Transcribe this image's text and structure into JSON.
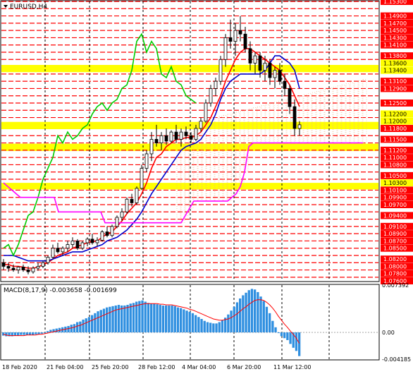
{
  "chart_data": [
    {
      "type": "candlestick",
      "symbol": "EURUSD,H4",
      "ylim": [
        1.076,
        1.153
      ],
      "y_ticks": [
        "1.15300",
        "1.14900",
        "1.14700",
        "1.14500",
        "1.14300",
        "1.14100",
        "1.13800",
        "1.13600",
        "1.13400",
        "1.13100",
        "1.12900",
        "1.12500",
        "1.12200",
        "1.12000",
        "1.11800",
        "1.11500",
        "1.11200",
        "1.11000",
        "1.10800",
        "1.10500",
        "1.10300",
        "1.10100",
        "1.09900",
        "1.09700",
        "1.09400",
        "1.09100",
        "1.08900",
        "1.08700",
        "1.08500",
        "1.08200",
        "1.08000",
        "1.07800",
        "1.07600"
      ],
      "highlight_ticks": [
        "1.13600",
        "1.13400",
        "1.12200",
        "1.12000",
        "1.10300"
      ],
      "x_ticks": [
        "18 Feb 2020",
        "21 Feb 04:00",
        "25 Feb 20:00",
        "28 Feb 12:00",
        "4 Mar 04:00",
        "6 Mar 20:00",
        "11 Mar 12:00"
      ],
      "red_levels": [
        1.153,
        1.151,
        1.149,
        1.147,
        1.145,
        1.143,
        1.141,
        1.139,
        1.137,
        1.133,
        1.131,
        1.129,
        1.127,
        1.125,
        1.123,
        1.121,
        1.116,
        1.114,
        1.112,
        1.11,
        1.108,
        1.106,
        1.104,
        1.101,
        1.099,
        1.097,
        1.095,
        1.093,
        1.091,
        1.089,
        1.087,
        1.085,
        1.083,
        1.081,
        1.079,
        1.077
      ],
      "yellow_bands": [
        [
          1.1335,
          1.1355
        ],
        [
          1.1178,
          1.1198
        ],
        [
          1.1118,
          1.1138
        ],
        [
          1.1012,
          1.103
        ]
      ],
      "candles": [
        [
          1.081,
          1.082,
          1.079,
          1.08
        ],
        [
          1.08,
          1.081,
          1.0785,
          1.0795
        ],
        [
          1.0795,
          1.0805,
          1.0785,
          1.079
        ],
        [
          1.079,
          1.08,
          1.078,
          1.0798
        ],
        [
          1.0798,
          1.0805,
          1.0785,
          1.079
        ],
        [
          1.079,
          1.08,
          1.0778,
          1.0785
        ],
        [
          1.0785,
          1.08,
          1.078,
          1.0795
        ],
        [
          1.0795,
          1.081,
          1.0788,
          1.08
        ],
        [
          1.08,
          1.0815,
          1.0795,
          1.081
        ],
        [
          1.081,
          1.083,
          1.0805,
          1.0825
        ],
        [
          1.0825,
          1.086,
          1.082,
          1.085
        ],
        [
          1.085,
          1.0865,
          1.0835,
          1.084
        ],
        [
          1.084,
          1.0855,
          1.083,
          1.085
        ],
        [
          1.085,
          1.087,
          1.084,
          1.086
        ],
        [
          1.086,
          1.088,
          1.085,
          1.087
        ],
        [
          1.087,
          1.0875,
          1.0845,
          1.085
        ],
        [
          1.085,
          1.087,
          1.0845,
          1.0865
        ],
        [
          1.0865,
          1.088,
          1.0855,
          1.0875
        ],
        [
          1.0875,
          1.089,
          1.086,
          1.0865
        ],
        [
          1.0865,
          1.088,
          1.0855,
          1.0872
        ],
        [
          1.0872,
          1.09,
          1.0868,
          1.0895
        ],
        [
          1.0895,
          1.091,
          1.088,
          1.0885
        ],
        [
          1.0885,
          1.0915,
          1.088,
          1.091
        ],
        [
          1.091,
          1.094,
          1.0905,
          1.0935
        ],
        [
          1.0935,
          1.096,
          1.0925,
          1.095
        ],
        [
          1.095,
          1.099,
          1.0945,
          1.0985
        ],
        [
          1.0985,
          1.1,
          1.0965,
          1.0975
        ],
        [
          1.0975,
          1.102,
          1.097,
          1.1015
        ],
        [
          1.1015,
          1.108,
          1.101,
          1.107
        ],
        [
          1.107,
          1.112,
          1.106,
          1.111
        ],
        [
          1.111,
          1.117,
          1.109,
          1.115
        ],
        [
          1.115,
          1.119,
          1.113,
          1.114
        ],
        [
          1.114,
          1.117,
          1.112,
          1.116
        ],
        [
          1.116,
          1.118,
          1.1135,
          1.1145
        ],
        [
          1.1145,
          1.1175,
          1.114,
          1.117
        ],
        [
          1.117,
          1.119,
          1.114,
          1.115
        ],
        [
          1.115,
          1.118,
          1.113,
          1.117
        ],
        [
          1.117,
          1.1185,
          1.115,
          1.116
        ],
        [
          1.116,
          1.117,
          1.114,
          1.115
        ],
        [
          1.115,
          1.119,
          1.1145,
          1.118
        ],
        [
          1.118,
          1.121,
          1.117,
          1.12
        ],
        [
          1.12,
          1.126,
          1.1195,
          1.125
        ],
        [
          1.125,
          1.13,
          1.124,
          1.129
        ],
        [
          1.129,
          1.132,
          1.127,
          1.131
        ],
        [
          1.131,
          1.138,
          1.13,
          1.137
        ],
        [
          1.137,
          1.144,
          1.135,
          1.143
        ],
        [
          1.143,
          1.148,
          1.14,
          1.142
        ],
        [
          1.142,
          1.147,
          1.138,
          1.145
        ],
        [
          1.145,
          1.149,
          1.142,
          1.144
        ],
        [
          1.144,
          1.146,
          1.139,
          1.14
        ],
        [
          1.14,
          1.142,
          1.134,
          1.136
        ],
        [
          1.136,
          1.139,
          1.133,
          1.138
        ],
        [
          1.138,
          1.139,
          1.132,
          1.134
        ],
        [
          1.134,
          1.138,
          1.131,
          1.136
        ],
        [
          1.136,
          1.137,
          1.13,
          1.132
        ],
        [
          1.132,
          1.135,
          1.129,
          1.134
        ],
        [
          1.134,
          1.136,
          1.13,
          1.131
        ],
        [
          1.131,
          1.133,
          1.127,
          1.129
        ],
        [
          1.129,
          1.13,
          1.122,
          1.124
        ],
        [
          1.124,
          1.126,
          1.116,
          1.118
        ],
        [
          1.118,
          1.12,
          1.116,
          1.119
        ]
      ],
      "lines": [
        {
          "name": "tenkan",
          "color": "#ff0000",
          "values": [
            1.0805,
            1.0805,
            1.08,
            1.08,
            1.0798,
            1.0795,
            1.0795,
            1.0798,
            1.0805,
            1.081,
            1.082,
            1.083,
            1.0835,
            1.084,
            1.085,
            1.0855,
            1.086,
            1.0865,
            1.0868,
            1.087,
            1.088,
            1.089,
            1.0895,
            1.091,
            1.0925,
            1.0945,
            1.096,
            1.0975,
            1.1,
            1.103,
            1.107,
            1.11,
            1.111,
            1.113,
            1.114,
            1.115,
            1.115,
            1.1155,
            1.1155,
            1.116,
            1.117,
            1.119,
            1.121,
            1.124,
            1.127,
            1.131,
            1.134,
            1.137,
            1.139,
            1.14,
            1.14,
            1.139,
            1.138,
            1.137,
            1.136,
            1.135,
            1.134,
            1.132,
            1.13,
            1.127,
            1.124
          ]
        },
        {
          "name": "kijun",
          "color": "#0000cc",
          "values": [
            1.083,
            1.083,
            1.083,
            1.0825,
            1.082,
            1.0815,
            1.0815,
            1.0815,
            1.0815,
            1.0815,
            1.082,
            1.0825,
            1.083,
            1.0835,
            1.084,
            1.084,
            1.084,
            1.0845,
            1.085,
            1.0855,
            1.086,
            1.087,
            1.0875,
            1.088,
            1.089,
            1.09,
            1.0915,
            1.093,
            1.095,
            1.0975,
            1.1,
            1.102,
            1.104,
            1.106,
            1.108,
            1.11,
            1.112,
            1.113,
            1.1135,
            1.114,
            1.115,
            1.117,
            1.119,
            1.122,
            1.126,
            1.129,
            1.131,
            1.132,
            1.133,
            1.133,
            1.133,
            1.133,
            1.133,
            1.134,
            1.136,
            1.138,
            1.138,
            1.137,
            1.136,
            1.134,
            1.129
          ]
        },
        {
          "name": "chikou",
          "color": "#00cc00",
          "values": [
            1.085,
            1.086,
            1.083,
            1.086,
            1.09,
            1.094,
            1.095,
            1.099,
            1.104,
            1.107,
            1.11,
            1.116,
            1.114,
            1.117,
            1.115,
            1.116,
            1.118,
            1.119,
            1.122,
            1.124,
            1.125,
            1.123,
            1.125,
            1.126,
            1.129,
            1.13,
            1.134,
            1.142,
            1.144,
            1.139,
            1.142,
            1.14,
            1.133,
            1.132,
            1.135,
            1.131,
            1.13,
            1.127,
            1.126,
            1.125
          ]
        },
        {
          "name": "senkou_b",
          "color": "#ff00ff",
          "values": [
            1.103,
            1.102,
            1.101,
            1.1,
            1.099,
            1.099,
            1.099,
            1.099,
            1.099,
            1.099,
            1.099,
            1.099,
            1.099,
            1.095,
            1.095,
            1.095,
            1.095,
            1.095,
            1.095,
            1.095,
            1.095,
            1.095,
            1.095,
            1.095,
            1.092,
            1.092,
            1.092,
            1.092,
            1.092,
            1.092,
            1.092,
            1.092,
            1.092,
            1.092,
            1.092,
            1.092,
            1.092,
            1.092,
            1.092,
            1.092,
            1.092,
            1.092,
            1.092,
            1.094,
            1.096,
            1.098,
            1.098,
            1.098,
            1.098,
            1.098,
            1.098,
            1.098,
            1.098,
            1.098,
            1.099,
            1.1,
            1.102,
            1.106,
            1.113,
            1.114,
            1.114,
            1.114,
            1.114,
            1.114,
            1.114,
            1.114,
            1.114,
            1.114,
            1.114,
            1.114,
            1.114,
            1.114,
            1.114,
            1.114,
            1.114,
            1.114,
            1.114,
            1.114,
            1.114,
            1.114,
            1.114,
            1.114,
            1.114,
            1.114,
            1.114,
            1.114
          ]
        }
      ]
    },
    {
      "type": "bar",
      "title": "MACD(8,17,9) -0.003658 -0.001699",
      "y_ticks": [
        "0.007392",
        "0.00",
        "-0.004185"
      ],
      "ylim": [
        -0.004185,
        0.007392
      ],
      "values": [
        -0.0005,
        -0.0006,
        -0.0006,
        -0.0006,
        -0.0005,
        -0.0005,
        -0.0004,
        -0.0004,
        -0.0004,
        -0.0004,
        -0.0004,
        -0.0003,
        -0.0003,
        -0.0002,
        -0.0001,
        0.0002,
        0.0004,
        0.0005,
        0.0006,
        0.0007,
        0.0008,
        0.0009,
        0.001,
        0.0012,
        0.0013,
        0.0016,
        0.0017,
        0.002,
        0.0022,
        0.0024,
        0.0027,
        0.003,
        0.0033,
        0.0035,
        0.0037,
        0.0039,
        0.004,
        0.0041,
        0.0042,
        0.0043,
        0.0042,
        0.0042,
        0.0043,
        0.0045,
        0.0046,
        0.0048,
        0.0049,
        0.005,
        0.0048,
        0.0046,
        0.0045,
        0.0045,
        0.0044,
        0.0043,
        0.0042,
        0.0042,
        0.0042,
        0.0042,
        0.0041,
        0.0039,
        0.0038,
        0.0036,
        0.0034,
        0.0032,
        0.003,
        0.0027,
        0.0024,
        0.0021,
        0.0018,
        0.0016,
        0.0015,
        0.0014,
        0.0014,
        0.0016,
        0.0019,
        0.0023,
        0.0028,
        0.0034,
        0.004,
        0.0047,
        0.0053,
        0.0058,
        0.0062,
        0.0066,
        0.0068,
        0.0067,
        0.0063,
        0.0056,
        0.0049,
        0.004,
        0.003,
        0.0018,
        0.0008,
        -0.0001,
        -0.0006,
        -0.0009,
        -0.0012,
        -0.0018,
        -0.0024,
        -0.0029,
        -0.0037
      ],
      "signal": [
        -0.0003,
        -0.0004,
        -0.0005,
        -0.0005,
        -0.0005,
        -0.0005,
        -0.0005,
        -0.0005,
        -0.0004,
        -0.0004,
        -0.0004,
        -0.0004,
        -0.0003,
        -0.0003,
        -0.0002,
        -0.0001,
        0.0,
        0.0001,
        0.0002,
        0.0003,
        0.0004,
        0.0005,
        0.0006,
        0.0007,
        0.0008,
        0.001,
        0.0011,
        0.0013,
        0.0015,
        0.0017,
        0.0019,
        0.0021,
        0.0023,
        0.0025,
        0.0027,
        0.0029,
        0.0031,
        0.0033,
        0.0035,
        0.0036,
        0.0037,
        0.0038,
        0.0039,
        0.004,
        0.0041,
        0.0042,
        0.0043,
        0.0044,
        0.0045,
        0.0045,
        0.0045,
        0.0045,
        0.0045,
        0.0044,
        0.0044,
        0.0043,
        0.0043,
        0.0043,
        0.0042,
        0.0041,
        0.004,
        0.0039,
        0.0038,
        0.0036,
        0.0035,
        0.0033,
        0.0031,
        0.0029,
        0.0027,
        0.0025,
        0.0023,
        0.0021,
        0.002,
        0.0019,
        0.0019,
        0.002,
        0.0021,
        0.0023,
        0.0026,
        0.0029,
        0.0033,
        0.0037,
        0.004,
        0.0044,
        0.0047,
        0.005,
        0.0051,
        0.0051,
        0.005,
        0.0047,
        0.0043,
        0.0038,
        0.0032,
        0.0025,
        0.0019,
        0.0013,
        0.0008,
        0.0002,
        -0.0003,
        -0.0009,
        -0.0017
      ]
    }
  ]
}
